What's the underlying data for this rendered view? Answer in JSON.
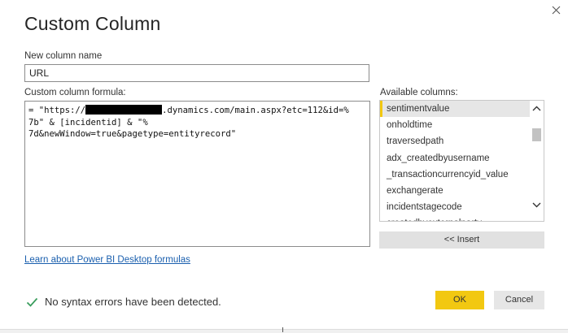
{
  "dialog": {
    "title": "Custom Column",
    "close_icon": "close-icon"
  },
  "name_field": {
    "label": "New column name",
    "value": "URL"
  },
  "formula": {
    "label": "Custom column formula:",
    "lines": [
      {
        "before": "= \"https://",
        "redacted": true,
        "after": ".dynamics.com/main.aspx?etc=112&id=%"
      },
      {
        "before": "7b\" & [incidentid] & \"%",
        "redacted": false,
        "after": ""
      },
      {
        "before": "7d&newWindow=true&pagetype=entityrecord\"",
        "redacted": false,
        "after": ""
      }
    ]
  },
  "available_columns": {
    "label": "Available columns:",
    "items": [
      "sentimentvalue",
      "onholdtime",
      "traversedpath",
      "adx_createdbyusername",
      "_transactioncurrencyid_value",
      "exchangerate",
      "incidentstagecode",
      "createdbyexternalparty"
    ],
    "selected_index": 0,
    "insert_label": "<< Insert"
  },
  "learn_link": "Learn about Power BI Desktop formulas",
  "status": {
    "icon": "check-icon",
    "text": "No syntax errors have been detected.",
    "color": "#3a9d5d"
  },
  "buttons": {
    "ok_label": "OK",
    "cancel_label": "Cancel"
  },
  "colors": {
    "accent": "#f2c811",
    "link": "#1a5fae"
  }
}
